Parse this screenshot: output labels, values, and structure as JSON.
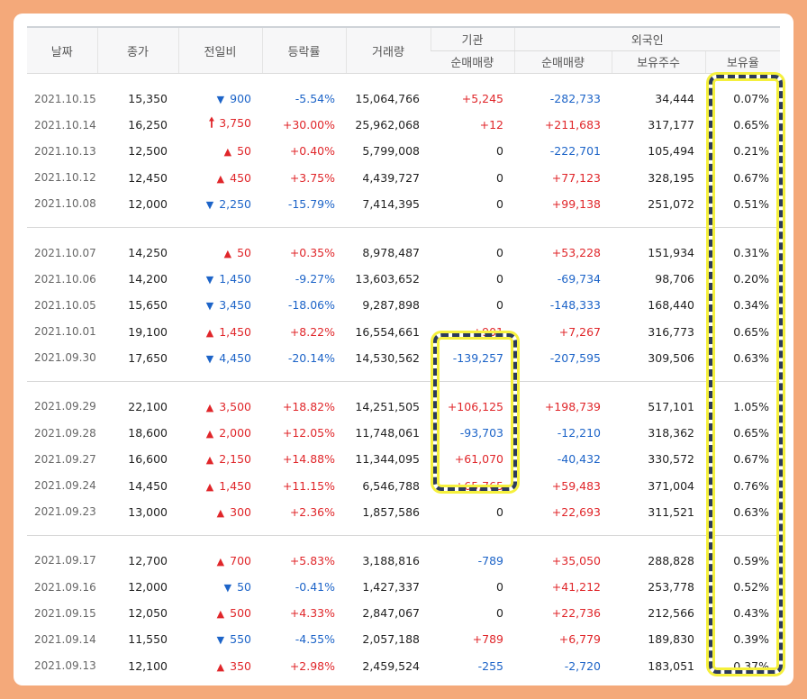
{
  "headers": {
    "date": "날짜",
    "close": "종가",
    "change": "전일비",
    "rate": "등락률",
    "volume": "거래량",
    "institution": "기관",
    "inst_net": "순매매량",
    "foreign": "외국인",
    "foreign_net": "순매매량",
    "foreign_shares": "보유주수",
    "foreign_ratio": "보유율"
  },
  "colors": {
    "up": "#e0262a",
    "down": "#1d64c8",
    "highlight_border": "#2c3a5c",
    "highlight_glow": "#f5f03d"
  },
  "groups": [
    [
      {
        "date": "2021.10.15",
        "close": "15,350",
        "dir": "down",
        "change": "900",
        "rate": "-5.54%",
        "volume": "15,064,766",
        "inst": "+5,245",
        "foreign_net": "-282,733",
        "shares": "34,444",
        "ratio": "0.07%"
      },
      {
        "date": "2021.10.14",
        "close": "16,250",
        "dir": "limit-up",
        "change": "3,750",
        "rate": "+30.00%",
        "volume": "25,962,068",
        "inst": "+12",
        "foreign_net": "+211,683",
        "shares": "317,177",
        "ratio": "0.65%"
      },
      {
        "date": "2021.10.13",
        "close": "12,500",
        "dir": "up",
        "change": "50",
        "rate": "+0.40%",
        "volume": "5,799,008",
        "inst": "0",
        "foreign_net": "-222,701",
        "shares": "105,494",
        "ratio": "0.21%"
      },
      {
        "date": "2021.10.12",
        "close": "12,450",
        "dir": "up",
        "change": "450",
        "rate": "+3.75%",
        "volume": "4,439,727",
        "inst": "0",
        "foreign_net": "+77,123",
        "shares": "328,195",
        "ratio": "0.67%"
      },
      {
        "date": "2021.10.08",
        "close": "12,000",
        "dir": "down",
        "change": "2,250",
        "rate": "-15.79%",
        "volume": "7,414,395",
        "inst": "0",
        "foreign_net": "+99,138",
        "shares": "251,072",
        "ratio": "0.51%"
      }
    ],
    [
      {
        "date": "2021.10.07",
        "close": "14,250",
        "dir": "up",
        "change": "50",
        "rate": "+0.35%",
        "volume": "8,978,487",
        "inst": "0",
        "foreign_net": "+53,228",
        "shares": "151,934",
        "ratio": "0.31%"
      },
      {
        "date": "2021.10.06",
        "close": "14,200",
        "dir": "down",
        "change": "1,450",
        "rate": "-9.27%",
        "volume": "13,603,652",
        "inst": "0",
        "foreign_net": "-69,734",
        "shares": "98,706",
        "ratio": "0.20%"
      },
      {
        "date": "2021.10.05",
        "close": "15,650",
        "dir": "down",
        "change": "3,450",
        "rate": "-18.06%",
        "volume": "9,287,898",
        "inst": "0",
        "foreign_net": "-148,333",
        "shares": "168,440",
        "ratio": "0.34%"
      },
      {
        "date": "2021.10.01",
        "close": "19,100",
        "dir": "up",
        "change": "1,450",
        "rate": "+8.22%",
        "volume": "16,554,661",
        "inst": "+901",
        "foreign_net": "+7,267",
        "shares": "316,773",
        "ratio": "0.65%"
      },
      {
        "date": "2021.09.30",
        "close": "17,650",
        "dir": "down",
        "change": "4,450",
        "rate": "-20.14%",
        "volume": "14,530,562",
        "inst": "-139,257",
        "foreign_net": "-207,595",
        "shares": "309,506",
        "ratio": "0.63%"
      }
    ],
    [
      {
        "date": "2021.09.29",
        "close": "22,100",
        "dir": "up",
        "change": "3,500",
        "rate": "+18.82%",
        "volume": "14,251,505",
        "inst": "+106,125",
        "foreign_net": "+198,739",
        "shares": "517,101",
        "ratio": "1.05%"
      },
      {
        "date": "2021.09.28",
        "close": "18,600",
        "dir": "up",
        "change": "2,000",
        "rate": "+12.05%",
        "volume": "11,748,061",
        "inst": "-93,703",
        "foreign_net": "-12,210",
        "shares": "318,362",
        "ratio": "0.65%"
      },
      {
        "date": "2021.09.27",
        "close": "16,600",
        "dir": "up",
        "change": "2,150",
        "rate": "+14.88%",
        "volume": "11,344,095",
        "inst": "+61,070",
        "foreign_net": "-40,432",
        "shares": "330,572",
        "ratio": "0.67%"
      },
      {
        "date": "2021.09.24",
        "close": "14,450",
        "dir": "up",
        "change": "1,450",
        "rate": "+11.15%",
        "volume": "6,546,788",
        "inst": "+65,765",
        "foreign_net": "+59,483",
        "shares": "371,004",
        "ratio": "0.76%"
      },
      {
        "date": "2021.09.23",
        "close": "13,000",
        "dir": "up",
        "change": "300",
        "rate": "+2.36%",
        "volume": "1,857,586",
        "inst": "0",
        "foreign_net": "+22,693",
        "shares": "311,521",
        "ratio": "0.63%"
      }
    ],
    [
      {
        "date": "2021.09.17",
        "close": "12,700",
        "dir": "up",
        "change": "700",
        "rate": "+5.83%",
        "volume": "3,188,816",
        "inst": "-789",
        "foreign_net": "+35,050",
        "shares": "288,828",
        "ratio": "0.59%"
      },
      {
        "date": "2021.09.16",
        "close": "12,000",
        "dir": "down",
        "change": "50",
        "rate": "-0.41%",
        "volume": "1,427,337",
        "inst": "0",
        "foreign_net": "+41,212",
        "shares": "253,778",
        "ratio": "0.52%"
      },
      {
        "date": "2021.09.15",
        "close": "12,050",
        "dir": "up",
        "change": "500",
        "rate": "+4.33%",
        "volume": "2,847,067",
        "inst": "0",
        "foreign_net": "+22,736",
        "shares": "212,566",
        "ratio": "0.43%"
      },
      {
        "date": "2021.09.14",
        "close": "11,550",
        "dir": "down",
        "change": "550",
        "rate": "-4.55%",
        "volume": "2,057,188",
        "inst": "+789",
        "foreign_net": "+6,779",
        "shares": "189,830",
        "ratio": "0.39%"
      },
      {
        "date": "2021.09.13",
        "close": "12,100",
        "dir": "up",
        "change": "350",
        "rate": "+2.98%",
        "volume": "2,459,524",
        "inst": "-255",
        "foreign_net": "-2,720",
        "shares": "183,051",
        "ratio": "0.37%"
      }
    ]
  ]
}
